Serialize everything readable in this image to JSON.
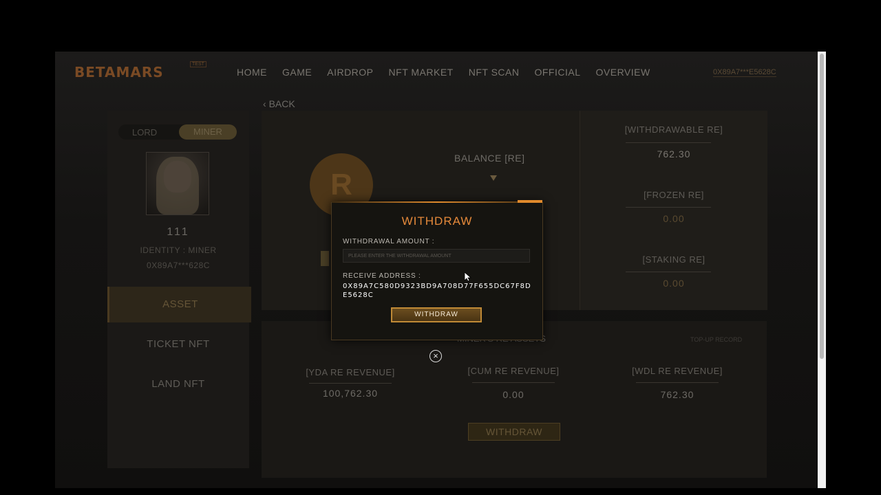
{
  "header": {
    "logo": "BETAMARS",
    "logo_badge": "TEST",
    "nav": [
      "HOME",
      "GAME",
      "AIRDROP",
      "NFT MARKET",
      "NFT SCAN",
      "OFFICIAL",
      "OVERVIEW"
    ],
    "wallet": "0X89A7***E5628C"
  },
  "back_label": "BACK",
  "sidebar": {
    "role_lord": "LORD",
    "role_miner": "MINER",
    "username": "111",
    "identity": "IDENTITY : MINER",
    "address_short": "0X89A7***628C",
    "menu": [
      "ASSET",
      "TICKET NFT",
      "LAND NFT"
    ]
  },
  "balance": {
    "label": "BALANCE [RE]",
    "coin_letter": "R"
  },
  "stats": {
    "withdrawable_label": "[WITHDRAWABLE RE]",
    "withdrawable_value": "762.30",
    "frozen_label": "[FROZEN RE]",
    "frozen_value": "0.00",
    "staking_label": "[STAKING RE]",
    "staking_value": "0.00"
  },
  "assets": {
    "title": "MINER'S RE ASSETS",
    "topup_link": "TOP-UP RECORD",
    "yda_label": "[YDA RE REVENUE]",
    "yda_value": "100,762.30",
    "cum_label": "[CUM RE REVENUE]",
    "cum_value": "0.00",
    "wdl_label": "[WDL RE REVENUE]",
    "wdl_value": "762.30",
    "withdraw_button": "WITHDRAW"
  },
  "modal": {
    "title": "WITHDRAW",
    "amount_label": "WITHDRAWAL AMOUNT :",
    "amount_placeholder": "PLEASE ENTER THE WITHDRAWAL AMOUNT",
    "address_label": "RECEIVE ADDRESS :",
    "address_value": "0X89A7C580D9323BD9A708D77F655DC67F8DE5628C",
    "button": "WITHDRAW"
  },
  "colors": {
    "accent": "#e5893a",
    "button_border": "#c08a36"
  }
}
